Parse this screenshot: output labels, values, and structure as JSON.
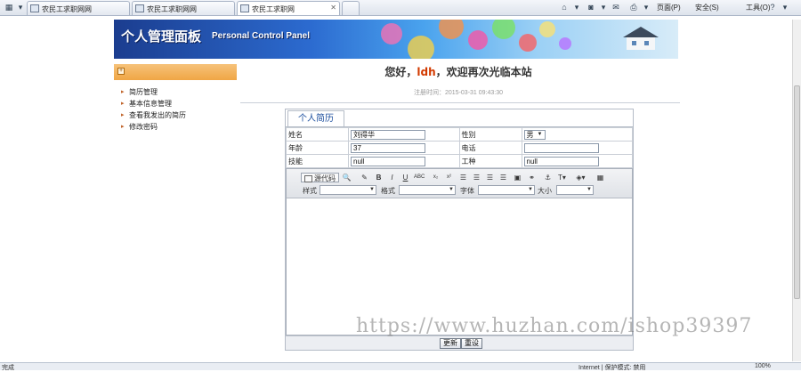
{
  "browser": {
    "tabs": [
      {
        "label": "农民工求职网网"
      },
      {
        "label": "农民工求职网网"
      },
      {
        "label": "农民工求职网"
      }
    ],
    "menus": {
      "page": "页面(P)",
      "safety": "安全(S)",
      "tools": "工具(O)"
    },
    "status": {
      "left": "完成",
      "zone": "Internet | 保护模式: 禁用",
      "zoom": "100%"
    }
  },
  "banner": {
    "title": "个人管理面板",
    "subtitle": "Personal Control Panel"
  },
  "sidebar": {
    "items": [
      {
        "label": "简历管理"
      },
      {
        "label": "基本信息管理"
      },
      {
        "label": "查看我发出的简历"
      },
      {
        "label": "修改密码"
      }
    ]
  },
  "welcome": {
    "prefix": "您好，",
    "name": "ldh",
    "suffix": "，欢迎再次光临本站",
    "register_time": "注册时间：2015-03-31 09:43:30"
  },
  "resume": {
    "tab_label": "个人简历",
    "fields": {
      "name_label": "姓名",
      "name_value": "刘得华",
      "gender_label": "性别",
      "gender_value": "男",
      "age_label": "年龄",
      "age_value": "37",
      "phone_label": "电话",
      "phone_value": "",
      "skill_label": "技能",
      "skill_value": "null",
      "job_label": "工种",
      "job_value": "null"
    },
    "editor": {
      "source_label": "源代码",
      "style_label": "样式",
      "format_label": "格式",
      "font_label": "字体",
      "size_label": "大小"
    },
    "buttons": {
      "update": "更新",
      "reset": "重设"
    }
  },
  "watermark": "https://www.huzhan.com/ishop39397"
}
